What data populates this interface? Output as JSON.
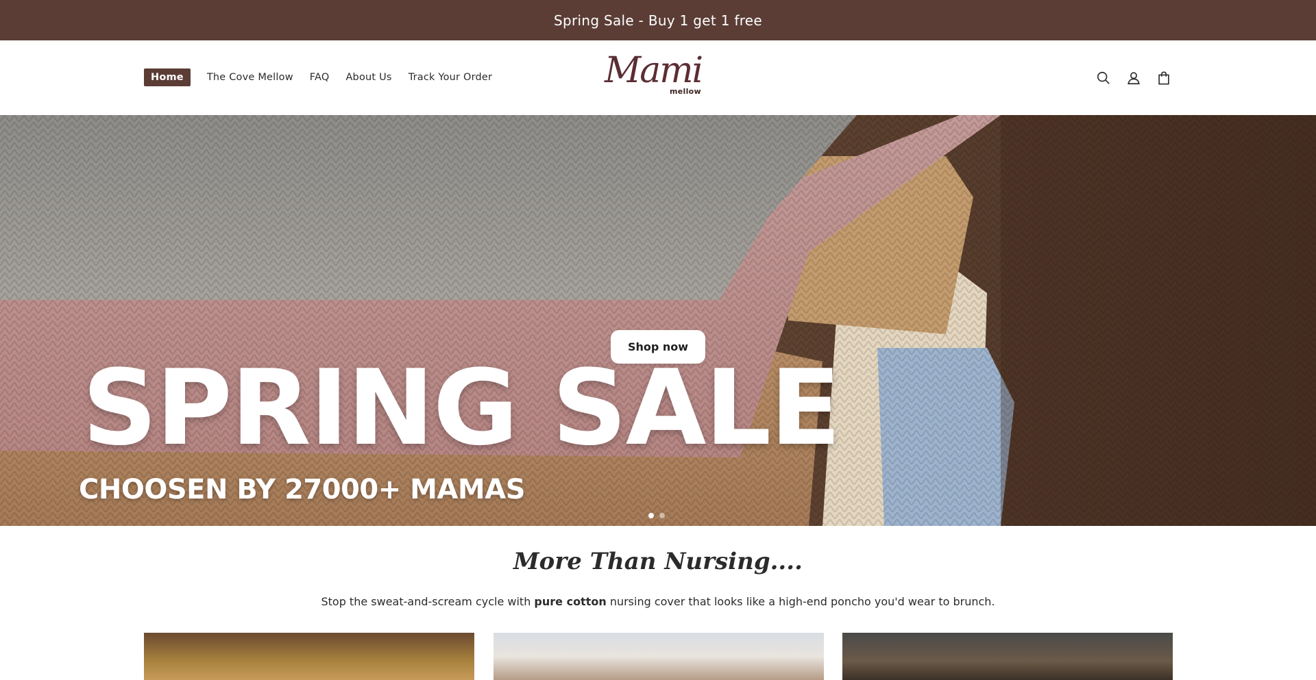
{
  "announcement": "Spring Sale - Buy 1 get 1 free",
  "nav": {
    "items": [
      {
        "label": "Home",
        "active": true
      },
      {
        "label": "The Cove Mellow"
      },
      {
        "label": "FAQ"
      },
      {
        "label": "About Us"
      },
      {
        "label": "Track Your Order"
      }
    ]
  },
  "logo": {
    "script": "Mami",
    "sub": "mellow"
  },
  "header_icons": [
    "search-icon",
    "account-icon",
    "cart-icon"
  ],
  "hero": {
    "title": "SPRING SALE",
    "subtitle": "CHOOSEN BY 27000+ MAMAS",
    "button": "Shop now",
    "slides": 2,
    "active_slide": 1
  },
  "section": {
    "title": "More Than Nursing....",
    "desc_before": "Stop the sweat-and-scream cycle with ",
    "desc_bold": "pure cotton",
    "desc_after": " nursing cover that looks like a high-end poncho you'd wear to brunch."
  },
  "colors": {
    "brand": "#5b3d36",
    "logo": "#5b2e34"
  }
}
